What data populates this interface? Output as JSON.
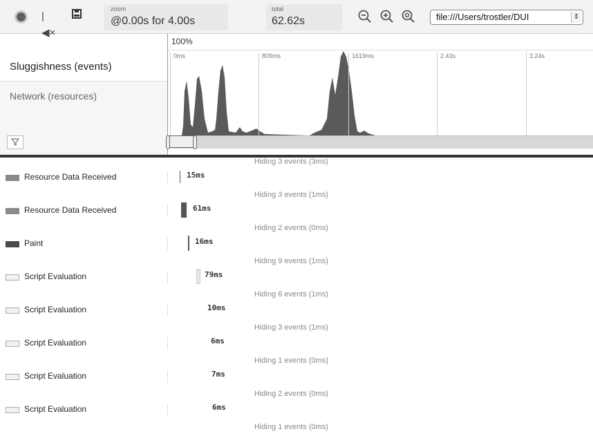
{
  "toolbar": {
    "record_icon": "record-icon",
    "clear_icon": "clear-icon",
    "save_icon": "save-icon",
    "zoom_label": "zoom",
    "zoom_value": "@0.00s for 4.00s",
    "total_label": "total",
    "total_value": "62.62s",
    "zoom_out_icon": "zoom-out-icon",
    "zoom_in_icon": "zoom-in-icon",
    "zoom_reset_icon": "zoom-reset-icon",
    "url_value": "file:///Users/trostler/DUI"
  },
  "overview": {
    "zoom_percent": "100%",
    "categories": [
      "Sluggishness (events)",
      "Network (resources)"
    ],
    "ticks": [
      "0ms",
      "809ms",
      "1619ms",
      "2.43s",
      "3.24s"
    ],
    "filter_icon": "filter-icon"
  },
  "events": [
    {
      "name": "Resource Data Received",
      "duration": "15ms",
      "hidden": "Hiding 3 events (1ms)",
      "color": "#8a8a8a"
    },
    {
      "name": "Resource Data Received",
      "duration": "61ms",
      "hidden": "Hiding 2 events (0ms)",
      "color": "#8a8a8a"
    },
    {
      "name": "Paint",
      "duration": "16ms",
      "hidden": "Hiding 9 events (1ms)",
      "color": "#4a4a4a"
    },
    {
      "name": "Script Evaluation",
      "duration": "79ms",
      "hidden": "Hiding 6 events (1ms)",
      "color": "#f2f2f2"
    },
    {
      "name": "Script Evaluation",
      "duration": "10ms",
      "hidden": "Hiding 3 events (1ms)",
      "color": "#f2f2f2"
    },
    {
      "name": "Script Evaluation",
      "duration": "6ms",
      "hidden": "Hiding 1 events (0ms)",
      "color": "#f2f2f2"
    },
    {
      "name": "Script Evaluation",
      "duration": "7ms",
      "hidden": "Hiding 2 events (0ms)",
      "color": "#f2f2f2"
    },
    {
      "name": "Script Evaluation",
      "duration": "6ms",
      "hidden": "Hiding 1 events (0ms)",
      "color": "#f2f2f2"
    }
  ],
  "top_hidden_partial": "Hiding 3 events (3ms)"
}
